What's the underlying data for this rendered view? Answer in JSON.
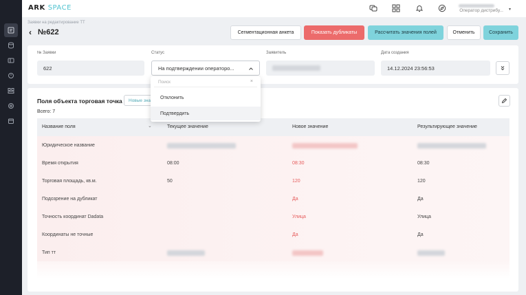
{
  "brand": {
    "logo_main": "ARK",
    "logo_accent": "SPACE",
    "accent_color": "#4fc3d0"
  },
  "topbar": {
    "icons": [
      "chat-icon",
      "grid-icon",
      "bell-icon",
      "compass-icon"
    ],
    "user_role": "Оператор дистрибу..."
  },
  "sidebar": {
    "icons": [
      "edit-list-icon",
      "database-icon",
      "layers-icon",
      "circle-icon",
      "users-icon",
      "globe-icon",
      "calendar-icon"
    ]
  },
  "header": {
    "breadcrumb": "Заявки на редактирование ТТ",
    "title": "№622",
    "buttons": {
      "segment": "Сегментационная анкета",
      "duplicates": "Показать дубликаты",
      "calculate": "Рассчитать значения полей",
      "cancel": "Отменить",
      "save": "Сохранить"
    }
  },
  "form": {
    "request_no_label": "№ Заявки",
    "request_no_value": "622",
    "status_label": "Статус",
    "status_value": "На подтверждении операторо...",
    "applicant_label": "Заявитель",
    "created_label": "Дата создания",
    "created_value": "14.12.2024 23:56:53"
  },
  "dropdown": {
    "search_placeholder": "Поиск",
    "options": [
      "Отклонить",
      "Подтвердить"
    ]
  },
  "table": {
    "title": "Поля объекта торговая точка",
    "new_values_button": "Новые значения",
    "count": "Всего: 7",
    "columns": [
      "Название поля",
      "Текущее значение",
      "Новое значение",
      "Результирующее значение"
    ],
    "rows": [
      {
        "name": "Юридическое название",
        "current": "",
        "new": "",
        "result": ""
      },
      {
        "name": "Время открытия",
        "current": "08:00",
        "new": "08:30",
        "result": "08:30"
      },
      {
        "name": "Торговая площадь, кв.м.",
        "current": "50",
        "new": "120",
        "result": "120"
      },
      {
        "name": "Подозрение на дубликат",
        "current": "",
        "new": "Да",
        "result": "Да"
      },
      {
        "name": "Точность координат Dadata",
        "current": "",
        "new": "Улица",
        "result": "Улица"
      },
      {
        "name": "Координаты не точные",
        "current": "",
        "new": "Да",
        "result": "Да"
      },
      {
        "name": "Тип тт",
        "current": "",
        "new": "",
        "result": ""
      }
    ]
  }
}
